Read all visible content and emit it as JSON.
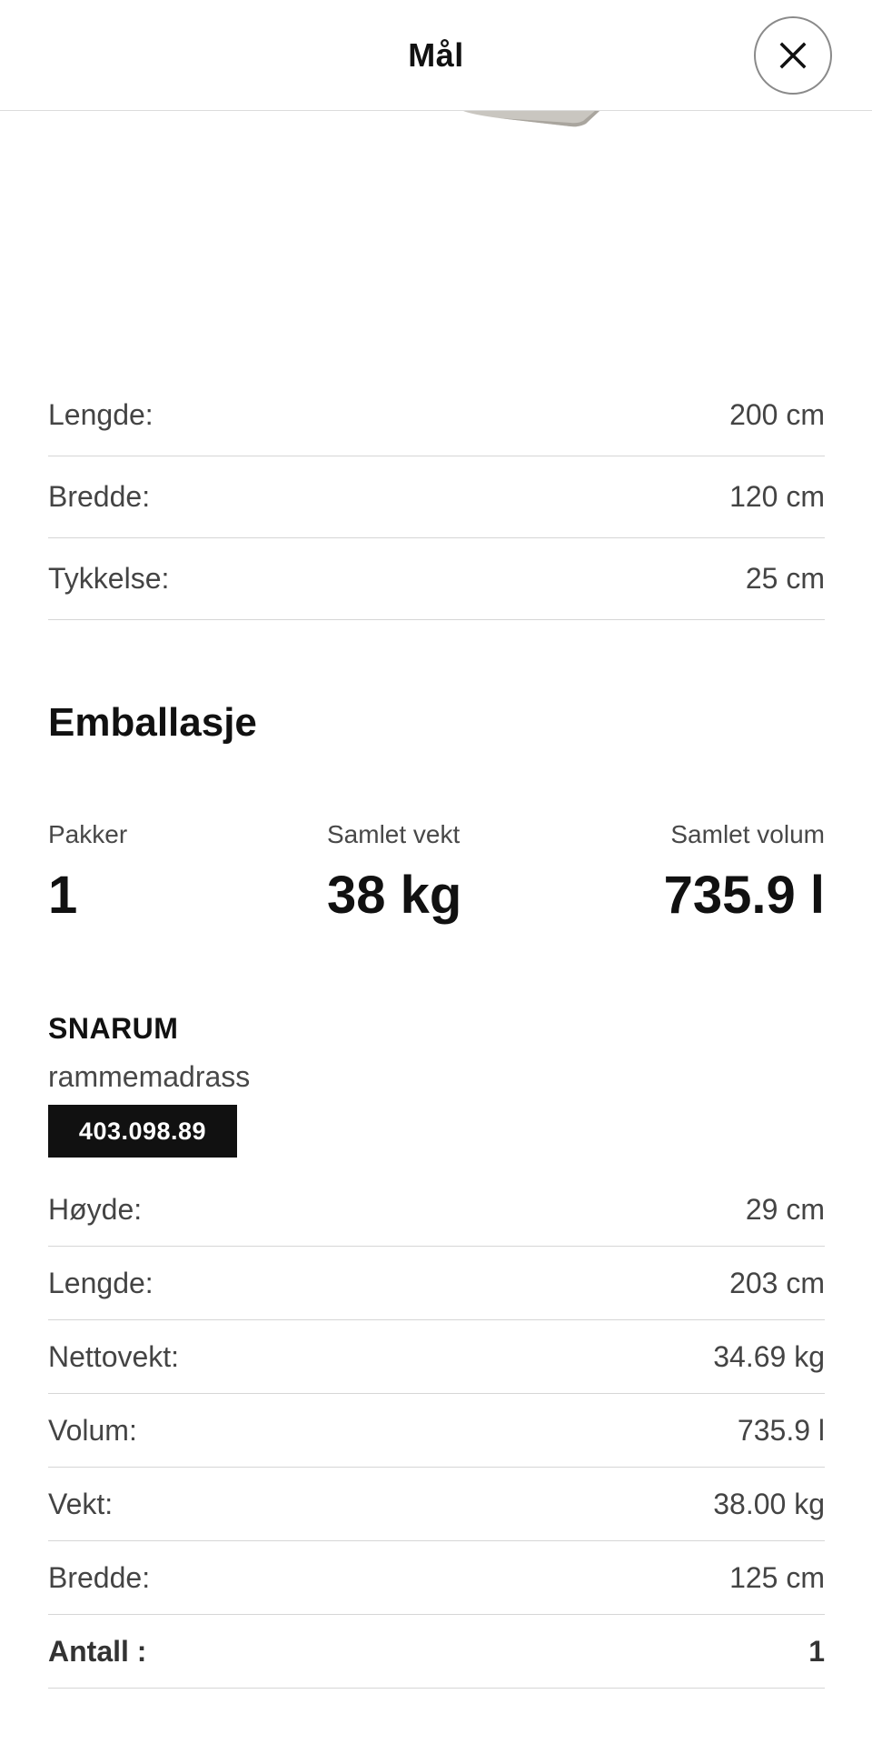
{
  "header": {
    "title": "Mål",
    "close_icon": "close-icon"
  },
  "dimensions": [
    {
      "label": "Lengde:",
      "value": "200 cm"
    },
    {
      "label": "Bredde:",
      "value": "120 cm"
    },
    {
      "label": "Tykkelse:",
      "value": "25 cm"
    }
  ],
  "packaging": {
    "title": "Emballasje",
    "summary": {
      "packages_label": "Pakker",
      "packages_value": "1",
      "weight_label": "Samlet vekt",
      "weight_value": "38 kg",
      "volume_label": "Samlet volum",
      "volume_value": "735.9 l"
    },
    "product": {
      "name": "SNARUM",
      "description": "rammemadrass",
      "article_number": "403.098.89"
    },
    "rows": [
      {
        "label": "Høyde:",
        "value": "29 cm"
      },
      {
        "label": "Lengde:",
        "value": "203 cm"
      },
      {
        "label": "Nettovekt:",
        "value": "34.69 kg"
      },
      {
        "label": "Volum:",
        "value": "735.9 l"
      },
      {
        "label": "Vekt:",
        "value": "38.00 kg"
      },
      {
        "label": "Bredde:",
        "value": "125 cm"
      }
    ],
    "total": {
      "label": "Antall :",
      "value": "1"
    }
  }
}
